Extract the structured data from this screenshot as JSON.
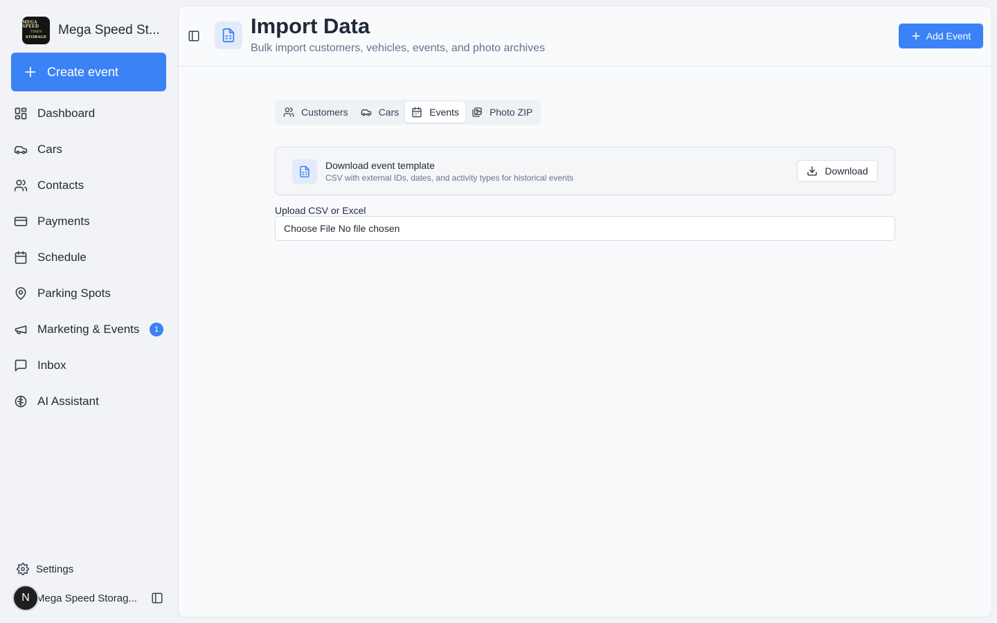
{
  "brand": {
    "name": "Mega Speed St...",
    "logo_text": [
      "MEGA SPEED",
      "TIRES",
      "STORAGE"
    ]
  },
  "sidebar": {
    "create_label": "Create event",
    "items": [
      {
        "label": "Dashboard",
        "icon": "dashboard-icon"
      },
      {
        "label": "Cars",
        "icon": "car-icon"
      },
      {
        "label": "Contacts",
        "icon": "users-icon"
      },
      {
        "label": "Payments",
        "icon": "credit-card-icon"
      },
      {
        "label": "Schedule",
        "icon": "calendar-icon"
      },
      {
        "label": "Parking Spots",
        "icon": "map-pin-icon"
      },
      {
        "label": "Marketing & Events",
        "icon": "megaphone-icon",
        "badge": "1"
      },
      {
        "label": "Inbox",
        "icon": "message-square-icon"
      },
      {
        "label": "AI Assistant",
        "icon": "brain-icon"
      }
    ],
    "settings_label": "Settings",
    "account": {
      "initial": "N",
      "name": "Mega Speed Storag..."
    }
  },
  "header": {
    "title": "Import Data",
    "subtitle": "Bulk import customers, vehicles, events, and photo archives",
    "add_event_label": "Add Event"
  },
  "tabs": [
    {
      "label": "Customers",
      "icon": "users-icon"
    },
    {
      "label": "Cars",
      "icon": "car-icon"
    },
    {
      "label": "Events",
      "icon": "calendar-icon",
      "active": true
    },
    {
      "label": "Photo ZIP",
      "icon": "images-icon"
    }
  ],
  "template_card": {
    "title": "Download event template",
    "description": "CSV with external IDs, dates, and activity types for historical events",
    "download_label": "Download"
  },
  "upload": {
    "label": "Upload CSV or Excel",
    "button_text": "Choose File",
    "status_text": "No file chosen"
  },
  "colors": {
    "accent": "#3b82f6",
    "sidebar_bg": "#f1f3f6",
    "main_bg": "#f8fafc",
    "icon_tint_bg": "#e3ebfb"
  }
}
